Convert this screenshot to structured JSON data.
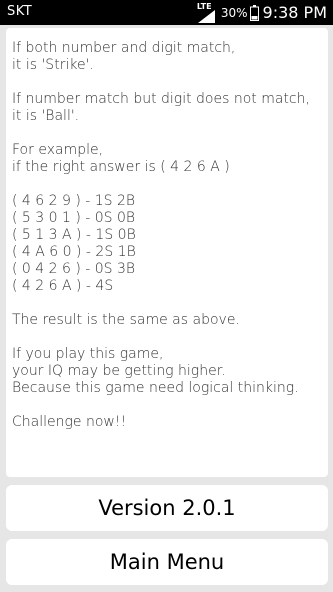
{
  "status_bar": {
    "carrier": "SKT",
    "network": "LTE",
    "battery_percent": "30%",
    "time": "9:38 PM"
  },
  "content": {
    "lines": [
      "If both number and digit match,",
      "it is 'Strike'.",
      "",
      "If number match but digit does not match,",
      "it is 'Ball'.",
      "",
      "For example,",
      "if the right answer is ( 4 2 6 A )",
      "",
      "( 4 6 2 9 ) - 1S 2B",
      "( 5 3 0 1 ) - 0S 0B",
      "( 5 1 3 A ) - 1S 0B",
      "( 4 A 6 0 ) - 2S 1B",
      "( 0 4 2 6 ) - 0S 3B",
      "( 4 2 6 A ) - 4S",
      "",
      "The result is the same as above.",
      "",
      "If you play this game,",
      "your IQ may be getting higher.",
      "Because this game need logical thinking.",
      "",
      "Challenge now!!"
    ]
  },
  "buttons": {
    "version_label": "Version 2.0.1",
    "main_menu_label": "Main Menu"
  },
  "colors": {
    "background": "#e6e6e6",
    "card": "#ffffff",
    "status_bar": "#000000",
    "text": "#333333"
  },
  "icons": {
    "signal": "signal-icon",
    "battery": "battery-icon"
  }
}
